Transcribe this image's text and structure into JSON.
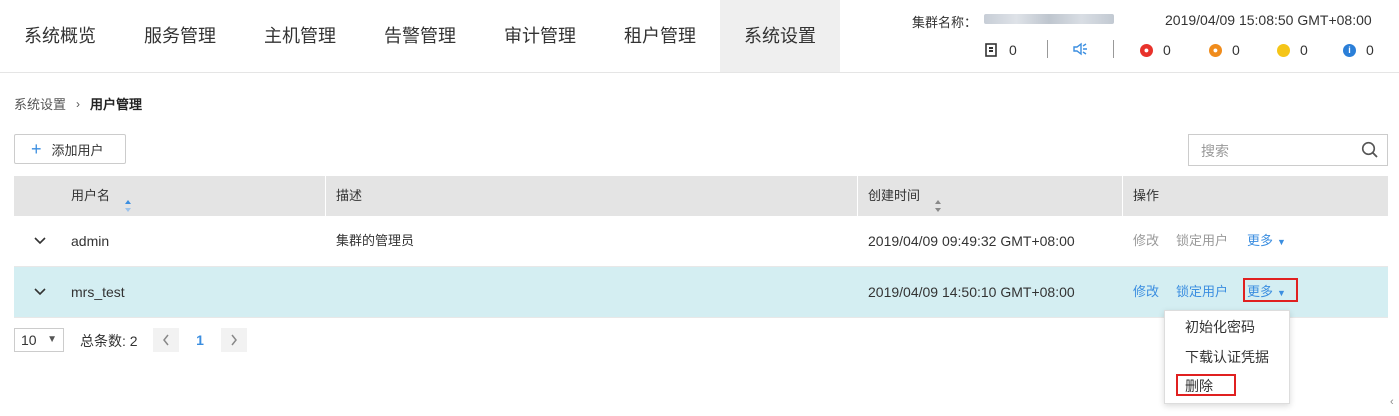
{
  "nav": {
    "tabs": [
      {
        "label": "系统概览"
      },
      {
        "label": "服务管理"
      },
      {
        "label": "主机管理"
      },
      {
        "label": "告警管理"
      },
      {
        "label": "审计管理"
      },
      {
        "label": "租户管理"
      },
      {
        "label": "系统设置",
        "active": true
      }
    ]
  },
  "header": {
    "cluster_label": "集群名称：",
    "datetime": "2019/04/09 15:08:50 GMT+08:00",
    "task_count": "0",
    "alarms": [
      {
        "count": "0",
        "color": "#e8322b"
      },
      {
        "count": "0",
        "color": "#f08c1c"
      },
      {
        "count": "0",
        "color": "#f5c518"
      },
      {
        "count": "0",
        "color": "#2b7fd8"
      }
    ]
  },
  "breadcrumb": {
    "parent": "系统设置",
    "current": "用户管理"
  },
  "toolbar": {
    "add_user_label": "添加用户",
    "search_placeholder": "搜索"
  },
  "table": {
    "headers": {
      "username": "用户名",
      "description": "描述",
      "created": "创建时间",
      "actions": "操作"
    },
    "rows": [
      {
        "username": "admin",
        "description": "集群的管理员",
        "created": "2019/04/09 09:49:32 GMT+08:00",
        "modify": "修改",
        "lock": "锁定用户",
        "more": "更多"
      },
      {
        "username": "mrs_test",
        "description": "",
        "created": "2019/04/09 14:50:10 GMT+08:00",
        "modify": "修改",
        "lock": "锁定用户",
        "more": "更多"
      }
    ]
  },
  "dropdown": {
    "items": [
      "初始化密码",
      "下载认证凭据",
      "删除"
    ]
  },
  "pagination": {
    "page_size": "10",
    "total_label": "总条数: 2",
    "current_page": "1"
  },
  "colors": {
    "accent": "#3b8ee0",
    "highlight_border": "#e02020",
    "selected_row": "#d4eef2"
  }
}
